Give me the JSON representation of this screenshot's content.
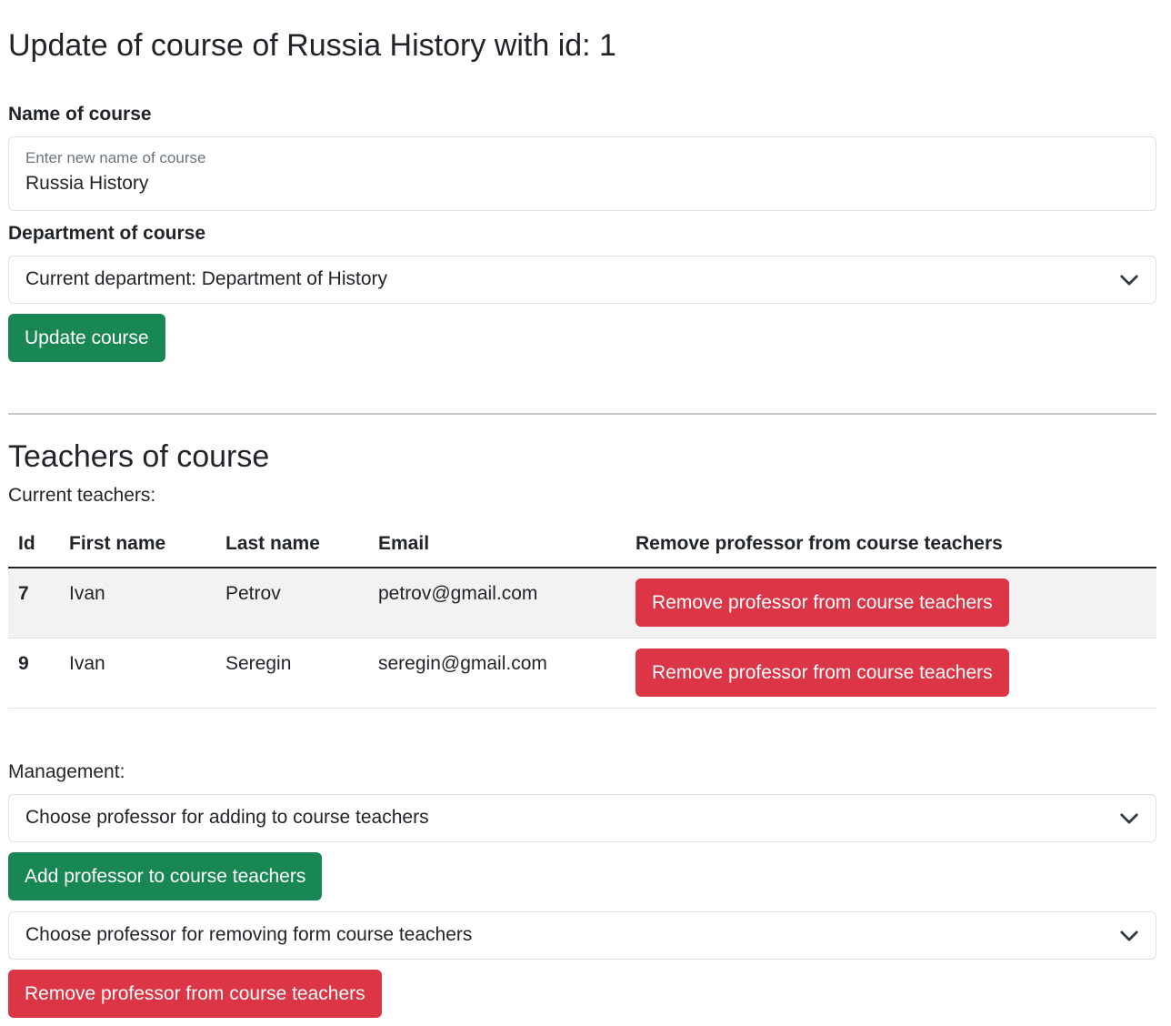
{
  "page_title": "Update of course of Russia History with id: 1",
  "form": {
    "name_label": "Name of course",
    "name_placeholder": "Enter new name of course",
    "name_value": "Russia History",
    "department_label": "Department of course",
    "department_selected": "Current department: Department of History",
    "update_button": "Update course"
  },
  "teachers": {
    "section_title": "Teachers of course",
    "current_label": "Current teachers:",
    "columns": [
      "Id",
      "First name",
      "Last name",
      "Email",
      "Remove professor from course teachers"
    ],
    "rows": [
      {
        "id": "7",
        "first_name": "Ivan",
        "last_name": "Petrov",
        "email": "petrov@gmail.com",
        "action": "Remove professor from course teachers"
      },
      {
        "id": "9",
        "first_name": "Ivan",
        "last_name": "Seregin",
        "email": "seregin@gmail.com",
        "action": "Remove professor from course teachers"
      }
    ]
  },
  "management": {
    "label": "Management:",
    "add_select": "Choose professor for adding to course teachers",
    "add_button": "Add professor to course teachers",
    "remove_select": "Choose professor for removing form course teachers",
    "remove_button": "Remove professor from course teachers"
  },
  "colors": {
    "success": "#198754",
    "danger": "#dc3545",
    "stripe": "#f2f2f2",
    "border": "#dee2e6"
  },
  "icons": {
    "select_chevron": "chevron-down-icon"
  }
}
